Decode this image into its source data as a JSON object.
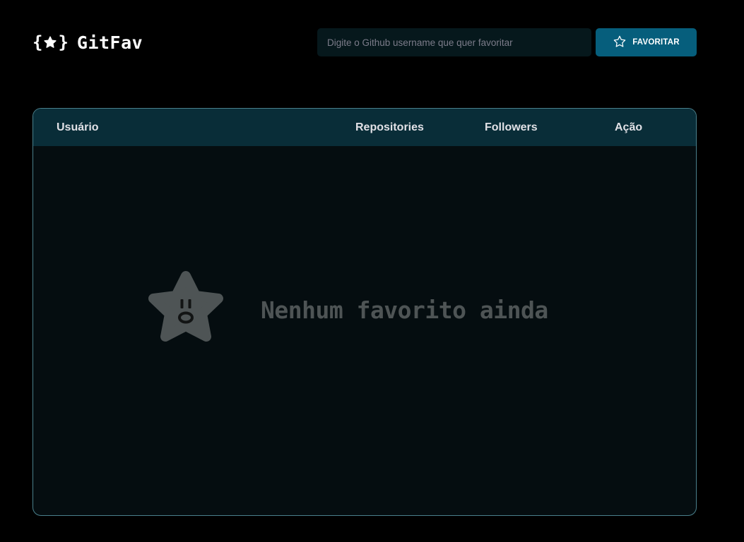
{
  "header": {
    "logo_text": "GitFav",
    "search": {
      "placeholder": "Digite o Github username que quer favoritar",
      "value": ""
    },
    "favorite_button_label": "FAVORITAR"
  },
  "table": {
    "columns": [
      "Usuário",
      "Repositories",
      "Followers",
      "Ação"
    ],
    "rows": [],
    "empty_state": {
      "icon": "sad-star-icon",
      "message": "Nenhum favorito ainda"
    }
  },
  "colors": {
    "background": "#000000",
    "input_background": "#06181C",
    "button_background": "#065E7C",
    "table_header_background": "#092D38",
    "table_body_background": "#050D10",
    "table_border": "#4A808C",
    "empty_state_color": "#4E5455"
  },
  "icons": {
    "logo": "star-braces-icon",
    "button": "star-outline-icon"
  }
}
